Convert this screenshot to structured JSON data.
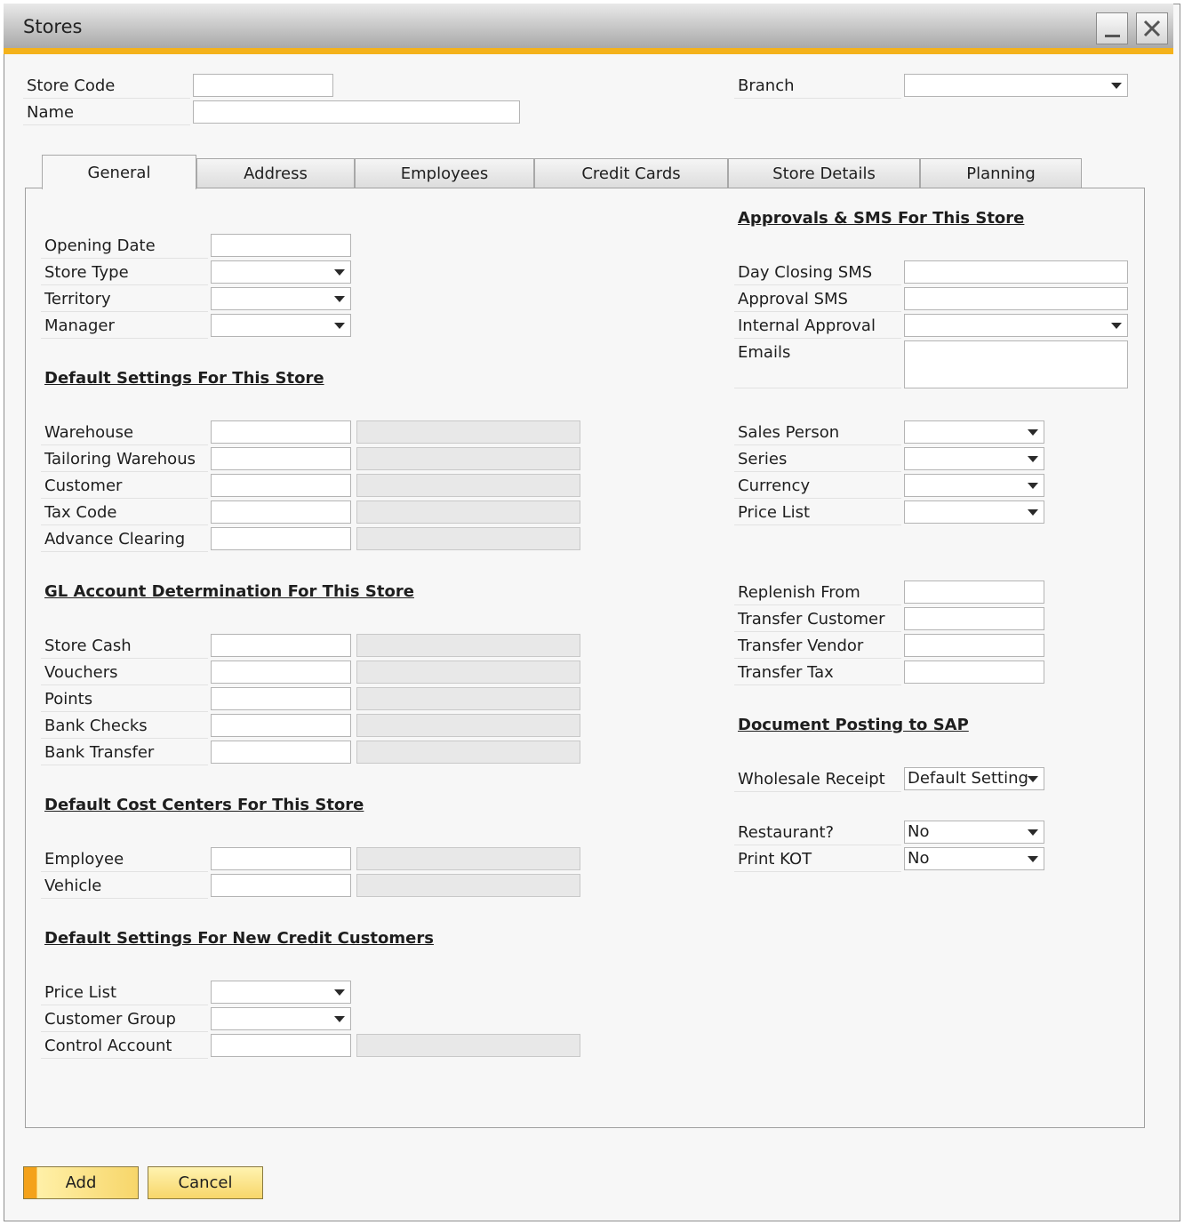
{
  "window": {
    "title": "Stores"
  },
  "header": {
    "store_code_label": "Store Code",
    "name_label": "Name",
    "branch_label": "Branch"
  },
  "tabs": [
    "General",
    "Address",
    "Employees",
    "Credit Cards",
    "Store Details",
    "Planning"
  ],
  "general": {
    "opening_date_label": "Opening Date",
    "store_type_label": "Store Type",
    "territory_label": "Territory",
    "manager_label": "Manager",
    "default_settings": {
      "heading": "Default Settings For This Store",
      "warehouse": "Warehouse",
      "tailoring_warehouse": "Tailoring Warehous",
      "customer": "Customer",
      "tax_code": "Tax Code",
      "advance_clearing": "Advance Clearing"
    },
    "gl_account": {
      "heading": "GL Account Determination For This Store",
      "store_cash": "Store Cash",
      "vouchers": "Vouchers",
      "points": "Points",
      "bank_checks": "Bank Checks",
      "bank_transfer": "Bank Transfer"
    },
    "cost_centers": {
      "heading": "Default Cost Centers For This Store",
      "employee": "Employee",
      "vehicle": "Vehicle"
    },
    "new_credit_customers": {
      "heading": "Default Settings For New Credit Customers",
      "price_list": "Price List",
      "customer_group": "Customer Group",
      "control_account": "Control Account"
    },
    "approvals": {
      "heading": "Approvals & SMS For This Store",
      "day_closing_sms": "Day Closing SMS",
      "approval_sms": "Approval SMS",
      "internal_approval": "Internal Approval",
      "emails": "Emails"
    },
    "sales": {
      "sales_person": "Sales Person",
      "series": "Series",
      "currency": "Currency",
      "price_list": "Price List"
    },
    "replenish": {
      "replenish_from": "Replenish From",
      "transfer_customer": "Transfer Customer",
      "transfer_vendor": "Transfer Vendor",
      "transfer_tax": "Transfer Tax"
    },
    "document_posting": {
      "heading": "Document Posting to SAP",
      "wholesale_receipt_label": "Wholesale Receipt",
      "wholesale_receipt_value": "Default Setting",
      "restaurant_label": "Restaurant?",
      "restaurant_value": "No",
      "print_kot_label": "Print KOT",
      "print_kot_value": "No"
    }
  },
  "footer": {
    "add_label": "Add",
    "cancel_label": "Cancel"
  }
}
